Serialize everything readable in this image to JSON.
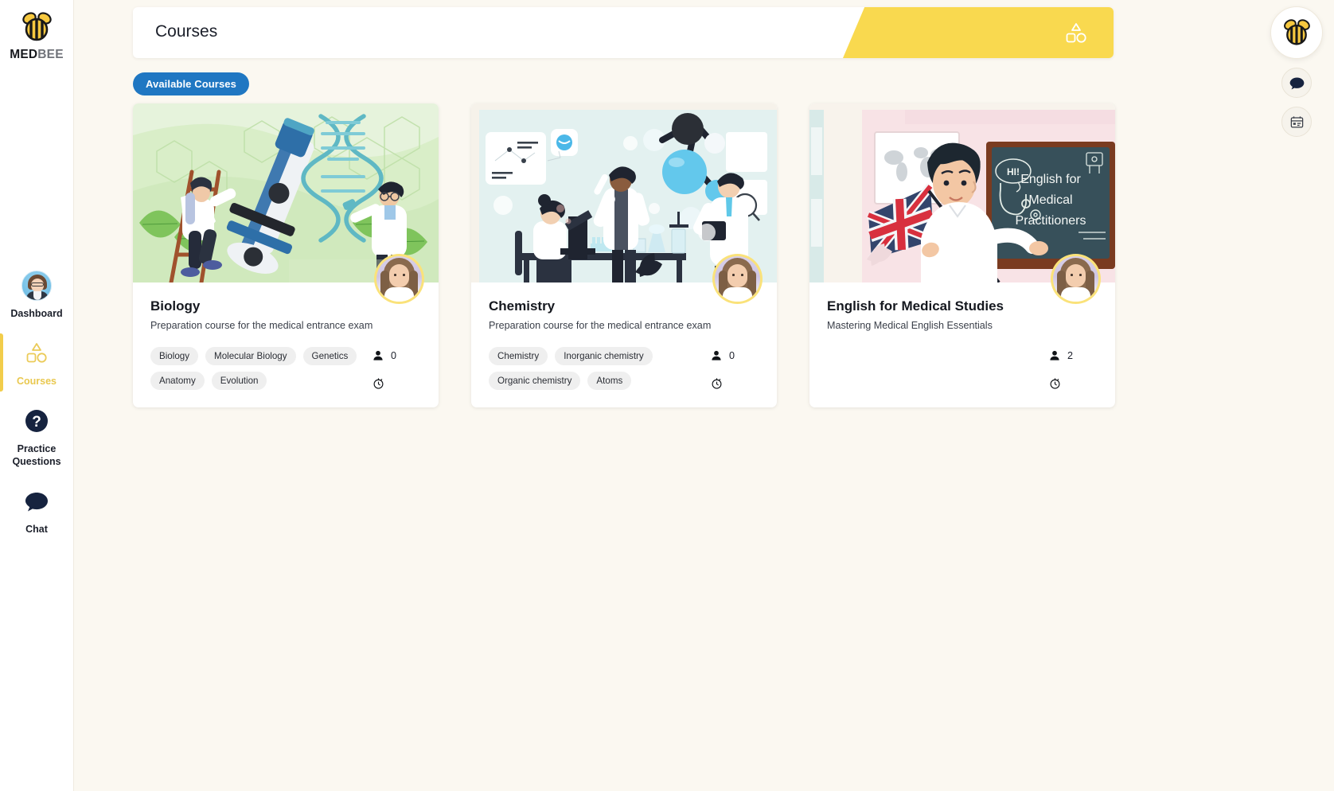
{
  "brand": {
    "name_med": "MED",
    "name_bee": "BEE",
    "logo_icon": "bee-icon"
  },
  "sidebar": {
    "items": [
      {
        "label": "Dashboard",
        "icon": "user-avatar-icon",
        "active": false
      },
      {
        "label": "Courses",
        "icon": "shapes-icon",
        "active": true
      },
      {
        "label": "Practice Questions",
        "icon": "question-mark-circle-icon",
        "active": false
      },
      {
        "label": "Chat",
        "icon": "chat-bubble-icon",
        "active": false
      }
    ]
  },
  "header": {
    "title": "Courses",
    "accent_color": "#F9D94F",
    "icon": "shapes-icon"
  },
  "tabs": [
    {
      "label": "Available Courses",
      "active": true,
      "color": "#1F77C2"
    }
  ],
  "float_buttons": [
    {
      "icon": "bee-icon",
      "name": "profile-bee-button"
    },
    {
      "icon": "chat-bubble-icon",
      "name": "chat-button"
    },
    {
      "icon": "calendar-icon",
      "name": "calendar-button"
    }
  ],
  "courses": [
    {
      "title": "Biology",
      "subtitle": "Preparation course for the medical entrance exam",
      "tags": [
        "Biology",
        "Molecular Biology",
        "Genetics",
        "Anatomy",
        "Evolution"
      ],
      "enrolled": "0",
      "enrolled_icon": "person-icon",
      "duration_icon": "stopwatch-icon",
      "art": "biology-illustration",
      "art_bg": "#E5F2DC",
      "instructor_avatar": "instructor-avatar"
    },
    {
      "title": "Chemistry",
      "subtitle": "Preparation course for the medical entrance exam",
      "tags": [
        "Chemistry",
        "Inorganic chemistry",
        "Organic chemistry",
        "Atoms"
      ],
      "enrolled": "0",
      "enrolled_icon": "person-icon",
      "duration_icon": "stopwatch-icon",
      "art": "chemistry-illustration",
      "art_bg": "#E2F0F0",
      "instructor_avatar": "instructor-avatar"
    },
    {
      "title": "English for Medical Studies",
      "subtitle": "Mastering Medical English Essentials",
      "tags": [],
      "enrolled": "2",
      "enrolled_icon": "person-icon",
      "duration_icon": "stopwatch-icon",
      "art": "english-illustration",
      "art_bg": "#F7E3E6",
      "art_board_text": [
        "English for",
        "Medical",
        "Practitioners"
      ],
      "art_bubble_text": "HI!",
      "instructor_avatar": "instructor-avatar"
    }
  ]
}
